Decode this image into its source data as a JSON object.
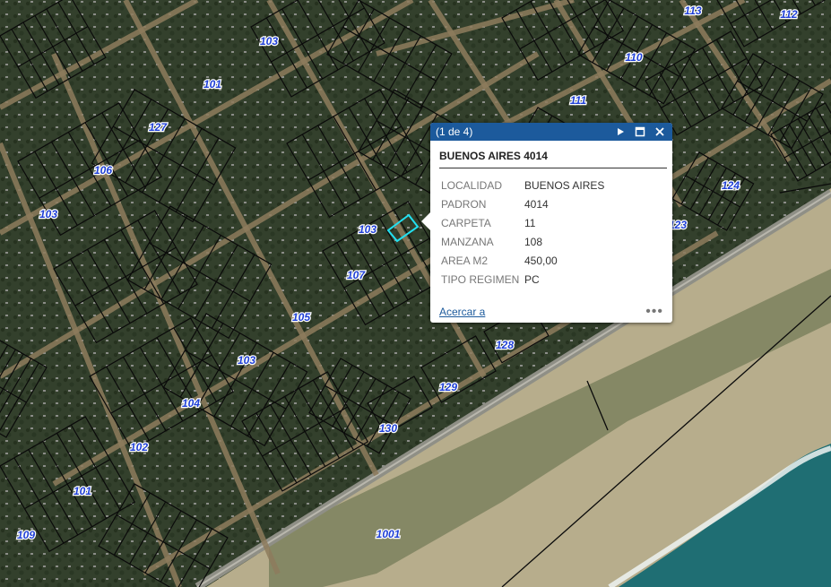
{
  "map": {
    "block_labels": [
      "103",
      "101",
      "127",
      "106",
      "103",
      "103",
      "107",
      "105",
      "103",
      "104",
      "102",
      "101",
      "109",
      "110",
      "111",
      "113",
      "112",
      "124",
      "123",
      "128",
      "129",
      "130",
      "1001"
    ]
  },
  "popup": {
    "count_text": "(1 de 4)",
    "title": "BUENOS AIRES 4014",
    "attributes": [
      {
        "key": "LOCALIDAD",
        "value": "BUENOS AIRES"
      },
      {
        "key": "PADRON",
        "value": "4014"
      },
      {
        "key": "CARPETA",
        "value": "11"
      },
      {
        "key": "MANZANA",
        "value": "108"
      },
      {
        "key": "AREA M2",
        "value": "450,00"
      },
      {
        "key": "TIPO REGIMEN",
        "value": "PC"
      }
    ],
    "zoom_link": "Acercar a",
    "more_label": "•••",
    "colors": {
      "header": "#1c5a9c",
      "selection": "#22e0f0"
    }
  }
}
